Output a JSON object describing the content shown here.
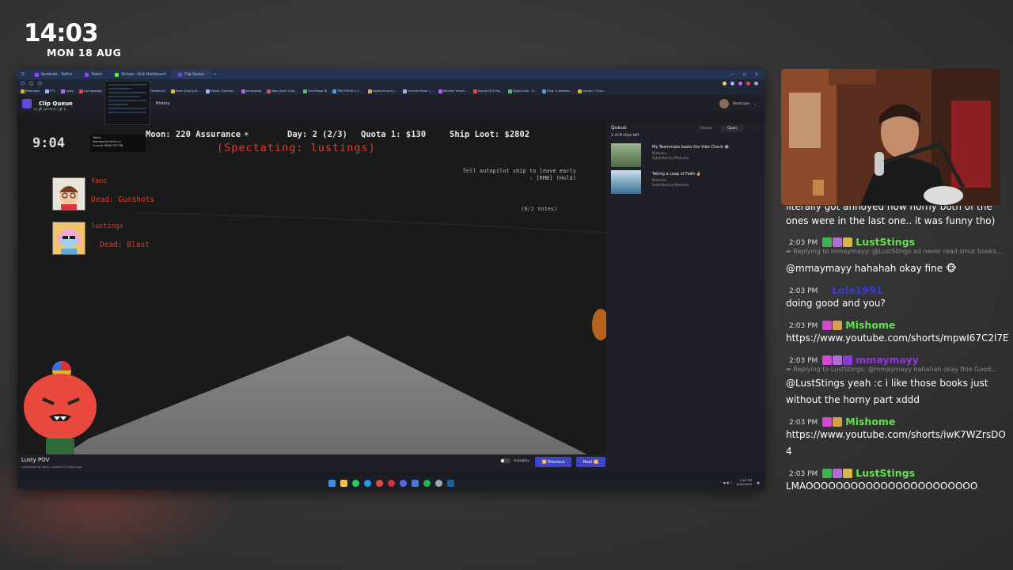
{
  "clock": {
    "time": "14:03",
    "date": "MON 18 AUG"
  },
  "browser": {
    "tabs": [
      "Symtools - Twitch",
      "Twitch",
      "Stream - Kick Dashboard",
      "Clip Queue"
    ],
    "bookmarks": [
      "Bootcape",
      "FFV",
      "Lusty",
      "Archipelago",
      "EON - Home",
      "TwitchTheater.tv",
      "Rank Drop's M...",
      "DeepL Translat...",
      "Scrapdrop",
      "Wau Deck Chat...",
      "The Ridge DJ",
      "TRUTHEAR x C...",
      "VaporV8.com |...",
      "Volume Mixer |...",
      "Monitor ViewS...",
      "Honda N1X Ro...",
      "SuperCook - Z...",
      "Ping: a webtoo...",
      "Gordon \"Crub..."
    ],
    "tooltip": {
      "title": "Twitch",
      "url": "dashboard.twitch.tv",
      "memory": "Current 8066.787 MB"
    }
  },
  "app": {
    "title": "Clip Queue",
    "subtitle": "by 🔗 JakeBMd | 🔗 B",
    "history": "History",
    "user": "Bootcape"
  },
  "game": {
    "time": "9:04",
    "moon": "Moon: 220 Assurance",
    "day": "Day: 2 (2/3)",
    "quota": "Quota 1: $130",
    "loot": "Ship Loot: $2802",
    "spectating": "(Spectating: lustings)",
    "tell_line1": "Tell autopilot ship to leave early",
    "tell_line2": ": [RMB] (Hold)",
    "votes": "(0/2 Votes)",
    "players": [
      {
        "name": "Yanc",
        "status": "Dead: Gunshots"
      },
      {
        "name": "lustings",
        "status": "Dead: Blast"
      }
    ]
  },
  "footer": {
    "clip_title": "Lusty POV",
    "clip_sub": "submitted by Yanc, created 24 days ago",
    "submitter": "Yanc",
    "autoplay": "Autoplay",
    "previous": "Previous",
    "next": "Next"
  },
  "queue": {
    "title": "Queue",
    "count": "2 of 8 clips left",
    "tab_closed": "Closed",
    "tab_open": "Open",
    "items": [
      {
        "name": "My Teammate beats the Vibe Check 😂",
        "channel": "Mishome",
        "by": "Submitted by Mishome"
      },
      {
        "name": "Taking a Leap of Faith 🤞",
        "channel": "Mishome",
        "by": "Submitted by Mishome"
      }
    ]
  },
  "taskbar": {
    "time": "2:03 PM",
    "date": "8/18/2025"
  },
  "chat": {
    "partial": "ones were in the last one.. it was funny tho)",
    "partial_top": "literally got annoyed how horny both of the",
    "messages": [
      {
        "time": "2:03 PM",
        "user": "LustStings",
        "color": "#62e24e",
        "reply": "Replying to mmaymayy: @LustStings xd never read smut books...",
        "text": "@mmaymayy hahahah okay fine 🐵"
      },
      {
        "time": "2:03 PM",
        "user": "Lole1991",
        "color": "#3b3ad7",
        "text": "doing good and you?"
      },
      {
        "time": "2:03 PM",
        "user": "Mishome",
        "color": "#62e24e",
        "text": "https://www.youtube.com/shorts/mpwI67C2l7E"
      },
      {
        "time": "2:03 PM",
        "user": "mmaymayy",
        "color": "#8a3ad6",
        "reply": "Replying to LustStings: @mmaymayy hahahah okay fine Good...",
        "text": "@LustStings yeah :c i like those books just",
        "text2": "without the horny part xddd"
      },
      {
        "time": "2:03 PM",
        "user": "Mishome",
        "color": "#62e24e",
        "text": "https://www.youtube.com/shorts/iwK7WZrsDO",
        "text2": "4"
      },
      {
        "time": "2:03 PM",
        "user": "LustStings",
        "color": "#62e24e",
        "text": "LMAOOOOOOOOOOOOOOOOOOOOOOO"
      }
    ]
  },
  "colors": {
    "accent": "#3e46c4",
    "dead_red": "#e23c2c",
    "chat_green": "#62e24e",
    "tab_bar": "#233352"
  }
}
